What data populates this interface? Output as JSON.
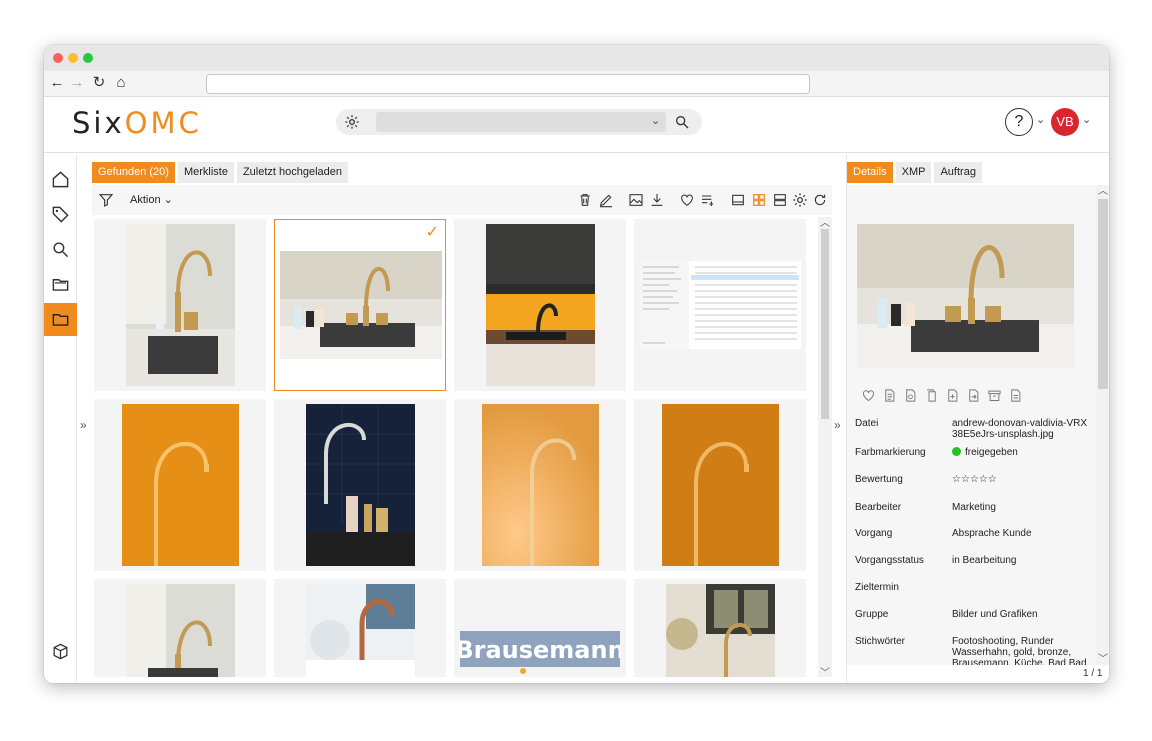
{
  "browser": {
    "url": ""
  },
  "header": {
    "logo_part1": "Six",
    "logo_part2": "OMC",
    "search_placeholder": "",
    "help_label": "?",
    "avatar_initials": "VB",
    "accent_color": "#f08b1d",
    "avatar_color": "#d9262e"
  },
  "sidebar": {
    "items": [
      {
        "name": "home-icon",
        "active": false
      },
      {
        "name": "tag-icon",
        "active": false
      },
      {
        "name": "search-icon",
        "active": false
      },
      {
        "name": "folder-open-icon",
        "active": false
      },
      {
        "name": "folder-icon",
        "active": true
      },
      {
        "name": "box-icon",
        "active": false
      }
    ]
  },
  "main": {
    "tabs": [
      {
        "label": "Gefunden (20)",
        "active": true
      },
      {
        "label": "Merkliste",
        "active": false
      },
      {
        "label": "Zuletzt hochgeladen",
        "active": false
      }
    ],
    "action_label": "Aktion",
    "grid_items": [
      {
        "kind": "faucet-portrait-marble",
        "selected": false
      },
      {
        "kind": "faucet-landscape-marble",
        "selected": true
      },
      {
        "kind": "faucet-dark-kitchen",
        "selected": false
      },
      {
        "kind": "file-list-screenshot",
        "selected": false
      },
      {
        "kind": "faucet-orange",
        "selected": false
      },
      {
        "kind": "faucet-black-tiles",
        "selected": false
      },
      {
        "kind": "faucet-orange-blur",
        "selected": false
      },
      {
        "kind": "faucet-orange",
        "selected": false
      },
      {
        "kind": "faucet-portrait-marble",
        "selected": false
      },
      {
        "kind": "copper-faucet-white",
        "selected": false
      },
      {
        "kind": "brausemann-logo",
        "selected": false,
        "text": "Brausemann"
      },
      {
        "kind": "faucet-window",
        "selected": false
      }
    ]
  },
  "right_panel": {
    "tabs": [
      {
        "label": "Details",
        "active": true
      },
      {
        "label": "XMP",
        "active": false
      },
      {
        "label": "Auftrag",
        "active": false
      }
    ],
    "fields": [
      {
        "key": "Datei",
        "value": "andrew-donovan-valdivia-VRX38E5eJrs-unsplash.jpg"
      },
      {
        "key": "Farbmarkierung",
        "value": "freigegeben",
        "status_color": "#22c41d"
      },
      {
        "key": "Bewertung",
        "value": "☆☆☆☆☆",
        "rating": 0
      },
      {
        "key": "Bearbeiter",
        "value": "Marketing"
      },
      {
        "key": "Vorgang",
        "value": "Absprache Kunde"
      },
      {
        "key": "Vorgangsstatus",
        "value": "in Bearbeitung"
      },
      {
        "key": "Zieltermin",
        "value": ""
      },
      {
        "key": "Gruppe",
        "value": "Bilder und Grafiken"
      },
      {
        "key": "Stichwörter",
        "value": "Footoshooting, Runder Wasserhahn, gold, bronze, Brausemann, Küche, Bad Bad"
      }
    ],
    "pager": "1 / 1"
  }
}
